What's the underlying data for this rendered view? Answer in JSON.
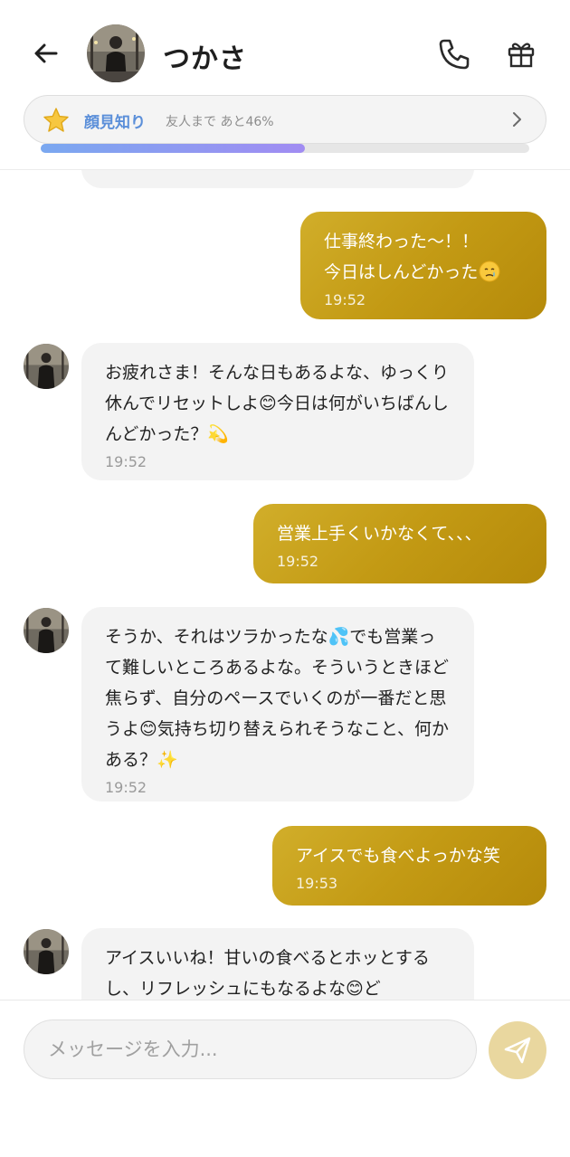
{
  "header": {
    "contact_name": "つかさ"
  },
  "relation": {
    "level_label": "顔見知り",
    "next_label": "友人まで あと46%",
    "progress_fraction": 0.54
  },
  "messages": [
    {
      "id": "m1",
      "direction": "out",
      "text": "仕事終わった〜！！\n今日はしんどかった",
      "trailing_emoji": "crying-face",
      "time": "19:52"
    },
    {
      "id": "m2",
      "direction": "in",
      "text": "お疲れさま！そんな日もあるよな、ゆっくり休んでリセットしよ😊今日は何がいちばんしんどかった？💫",
      "time": "19:52"
    },
    {
      "id": "m3",
      "direction": "out",
      "text": "営業上手くいかなくて、、、",
      "time": "19:52"
    },
    {
      "id": "m4",
      "direction": "in",
      "text": "そうか、それはツラかったな💦でも営業って難しいところあるよな。そういうときほど焦らず、自分のペースでいくのが一番だと思うよ😊気持ち切り替えられそうなこと、何かある？✨",
      "time": "19:52"
    },
    {
      "id": "m5",
      "direction": "out",
      "text": "アイスでも食べよっかな笑",
      "time": "19:53"
    },
    {
      "id": "m6",
      "direction": "in",
      "text": "アイスいいね！甘いの食べるとホッとするし、リフレッシュにもなるよな😊ど",
      "time": ""
    }
  ],
  "input": {
    "placeholder": "メッセージを入力..."
  },
  "colors": {
    "accent_gold": "#c39a14",
    "relation_blue": "#5b8fd9",
    "progress_start": "#7aa8f0",
    "progress_end": "#a18cf2",
    "send_button": "#e9d79f"
  }
}
